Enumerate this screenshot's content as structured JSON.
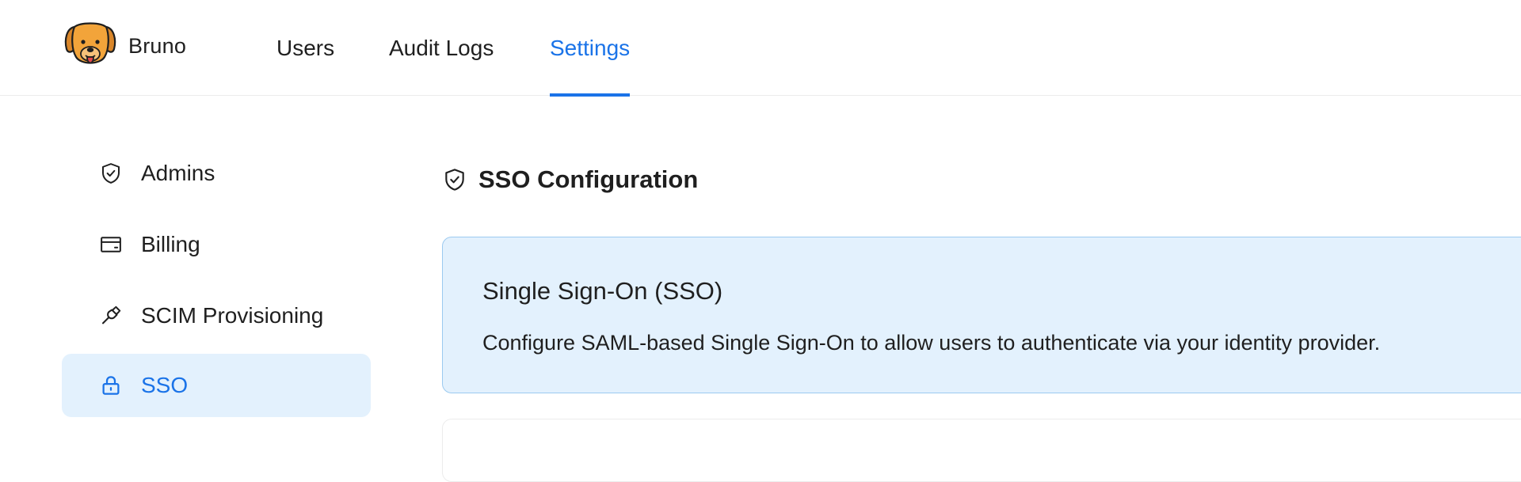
{
  "header": {
    "brand_name": "Bruno",
    "tabs": [
      {
        "label": "Users",
        "active": false
      },
      {
        "label": "Audit Logs",
        "active": false
      },
      {
        "label": "Settings",
        "active": true
      }
    ]
  },
  "sidebar": {
    "items": [
      {
        "label": "Admins",
        "icon": "shield-check-icon",
        "active": false
      },
      {
        "label": "Billing",
        "icon": "credit-card-icon",
        "active": false
      },
      {
        "label": "SCIM Provisioning",
        "icon": "plug-icon",
        "active": false
      },
      {
        "label": "SSO",
        "icon": "lock-icon",
        "active": true
      }
    ]
  },
  "main": {
    "section_title": "SSO Configuration",
    "section_icon": "shield-check-icon",
    "info_card": {
      "title": "Single Sign-On (SSO)",
      "description": "Configure SAML-based Single Sign-On to allow users to authenticate via your identity provider."
    }
  },
  "colors": {
    "accent": "#1a73e8",
    "active_background": "#e3f1fd",
    "card_border": "#9ccaf0",
    "brand_dog": "#f2a43a"
  }
}
